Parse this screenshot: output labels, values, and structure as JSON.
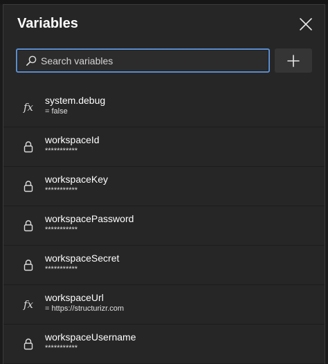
{
  "dialog": {
    "title": "Variables",
    "close_icon": "close-icon"
  },
  "search": {
    "placeholder": "Search variables",
    "value": "",
    "icon": "search-icon"
  },
  "add_button": {
    "icon": "plus-icon"
  },
  "colors": {
    "panel_bg": "#262626",
    "focus_border": "#5b8ed0",
    "text_primary": "#ffffff"
  },
  "variables": [
    {
      "name": "system.debug",
      "value": "= false",
      "icon": "fx-icon"
    },
    {
      "name": "workspaceId",
      "value": "***********",
      "icon": "lock-icon"
    },
    {
      "name": "workspaceKey",
      "value": "***********",
      "icon": "lock-icon"
    },
    {
      "name": "workspacePassword",
      "value": "***********",
      "icon": "lock-icon"
    },
    {
      "name": "workspaceSecret",
      "value": "***********",
      "icon": "lock-icon"
    },
    {
      "name": "workspaceUrl",
      "value": "= https://structurizr.com",
      "icon": "fx-icon"
    },
    {
      "name": "workspaceUsername",
      "value": "***********",
      "icon": "lock-icon"
    }
  ]
}
